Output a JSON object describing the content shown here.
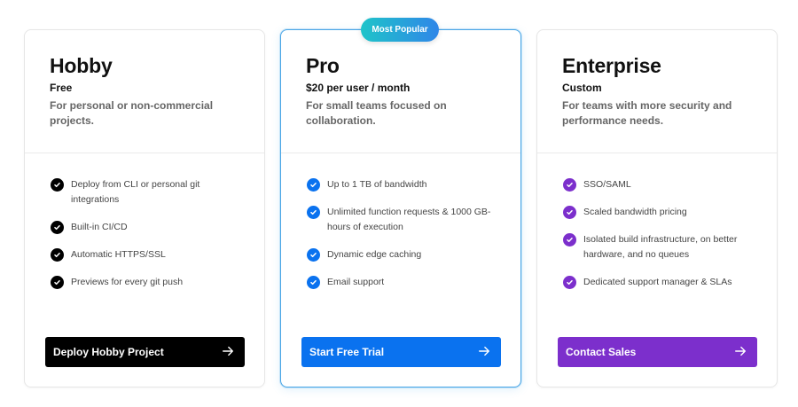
{
  "badge": {
    "label": "Most Popular",
    "color_from": "#1fc4c9",
    "color_to": "#2f86e8"
  },
  "plans": [
    {
      "name": "Hobby",
      "price": "Free",
      "description": "For personal or non-commercial projects.",
      "features": [
        "Deploy from CLI or personal git integrations",
        "Built-in CI/CD",
        "Automatic HTTPS/SSL",
        "Previews for every git push"
      ],
      "cta": "Deploy Hobby Project",
      "accent": "#000000",
      "check_icon": "check-circle-icon"
    },
    {
      "name": "Pro",
      "price": "$20 per user / month",
      "description": "For small teams focused on collaboration.",
      "features": [
        "Up to 1 TB of bandwidth",
        "Unlimited function requests & 1000 GB-hours of execution",
        "Dynamic edge caching",
        "Email support"
      ],
      "cta": "Start Free Trial",
      "accent": "#0a72ef",
      "check_icon": "check-circle-icon"
    },
    {
      "name": "Enterprise",
      "price": "Custom",
      "description": "For teams with more security and performance needs.",
      "features": [
        "SSO/SAML",
        "Scaled bandwidth pricing",
        "Isolated build infrastructure, on better hardware, and no queues",
        "Dedicated support manager & SLAs"
      ],
      "cta": "Contact Sales",
      "accent": "#7c2fcc",
      "check_icon": "check-circle-icon"
    }
  ]
}
